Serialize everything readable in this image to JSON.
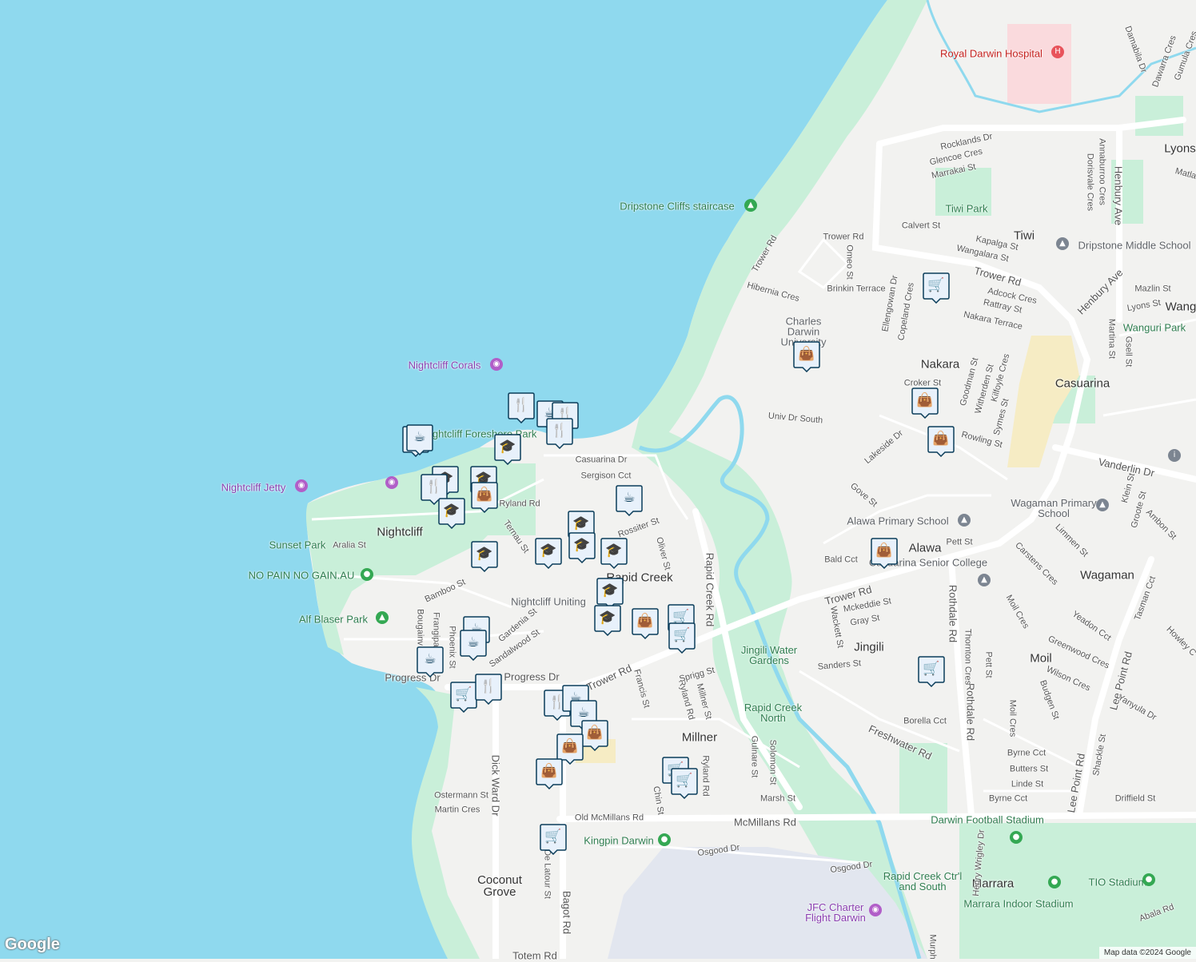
{
  "map": {
    "attribution": "Map data ©2024 Google",
    "logo": "Google",
    "colors": {
      "water": "#8fd9ee",
      "land": "#f2f2f0",
      "park": "#c9efd9",
      "road": "#ffffff",
      "hospital": "#fadadd",
      "commercial": "#f6ecc4",
      "airport": "#e6e8f0",
      "marker": "#0b3d5a",
      "markerFill": "#e8f1fb"
    }
  },
  "labels": {
    "royal_darwin_hospital": "Royal Darwin Hospital",
    "dripstone_cliffs": "Dripstone Cliffs staircase",
    "nightcliff_corals": "Nightcliff Corals",
    "nightcliff_foreshore": "Nightcliff Foreshore Park",
    "nightcliff_jetty": "Nightcliff Jetty",
    "sunset_park": "Sunset Park",
    "no_pain": "NO PAIN NO GAIN.AU",
    "alf_blaser": "Alf Blaser Park",
    "nightcliff": "Nightcliff",
    "rapid_creek": "Rapid Creek",
    "nightcliff_uniting": "Nightcliff Uniting",
    "millner": "Millner",
    "coconut_grove": "Coconut Grove",
    "kingpin": "Kingpin Darwin",
    "jfc_charter": "JFC Charter Flight Darwin",
    "rapid_creek_north": "Rapid Creek North",
    "jingili_water": "Jingili Water Gardens",
    "jingili": "Jingili",
    "moil": "Moil",
    "marrara": "Marrara",
    "tio_stadium": "TIO Stadium",
    "marrara_indoor": "Marrara Indoor Stadium",
    "darwin_football": "Darwin Football Stadium",
    "rapid_creek_ctrl": "Rapid Creek Ctr'l and South",
    "wagaman": "Wagaman",
    "wagaman_ps": "Wagaman Primary School",
    "alawa": "Alawa",
    "alawa_ps": "Alawa Primary School",
    "casuarina_sc": "Casuarina Senior College",
    "casuarina": "Casuarina",
    "nakara": "Nakara",
    "cdu": "Charles Darwin University",
    "tiwi": "Tiwi",
    "tiwi_park": "Tiwi Park",
    "dripstone_ms": "Dripstone Middle School",
    "lyons": "Lyons",
    "wanguri_park": "Wanguri Park",
    "wang": "Wang"
  },
  "streets": {
    "rocklands": "Rocklands Dr",
    "glencoe": "Glencoe Cres",
    "marrakai": "Marrakai St",
    "calvert": "Calvert St",
    "trower1": "Trower Rd",
    "trower2": "Trower Rd",
    "trower3": "Trower Rd",
    "trower4": "Trower Rd",
    "trower5": "Trower Rd",
    "kapalga": "Kapalga St",
    "wangalara": "Wangalara St",
    "adcock": "Adcock Cres",
    "rattray": "Rattray St",
    "nakara_terrace": "Nakara Terrace",
    "brinkin": "Brinkin Terrace",
    "hibernia": "Hibernia Cres",
    "omeo": "Omeo St",
    "ellengowan": "Ellengowan Dr",
    "copeland": "Copeland Cres",
    "annaburroo": "Annaburroo Cres",
    "dorisvale": "Dorisvale Cres",
    "henbury": "Henbury Ave",
    "henbury2": "Henbury Ave",
    "mazlin": "Mazlin St",
    "lyons_st": "Lyons St",
    "martina": "Martina St",
    "gsell": "Gsell St",
    "croker": "Croker St",
    "goodman": "Goodman St",
    "witherden": "Witherden St",
    "kilfoyle": "Kilfoyle Cres",
    "symes": "Symes St",
    "rowling": "Rowling St",
    "univ": "Univ Dr South",
    "lakeside": "Lakeside Dr",
    "gove": "Gove St",
    "vanderlin": "Vanderlin Dr",
    "limmen": "Limmen St",
    "ambon": "Ambon St",
    "groote": "Groote St",
    "klein": "Klein St",
    "pett": "Pett St",
    "bald": "Bald Cct",
    "carstens": "Carstens Cres",
    "mckeddie": "Mckeddie St",
    "gray": "Gray St",
    "wackett": "Wackett St",
    "sanders": "Sanders St",
    "rothdale1": "Rothdale Rd",
    "rothdale2": "Rothdale Rd",
    "thornton": "Thornton Cres",
    "petts": "Pett St",
    "moil_cres": "Moil Cres",
    "moil_cres2": "Moil Cres",
    "yeadon": "Yeadon Cct",
    "greenwood": "Greenwood Cres",
    "wilson": "Wilson Cres",
    "budgen": "Budgen St",
    "lee_point1": "Lee Point Rd",
    "lee_point2": "Lee Point Rd",
    "tasman": "Tasman Cct",
    "yanyula": "Yanyula Dr",
    "howley": "Howley C",
    "freshwater": "Freshwater Rd",
    "borella": "Borella Cct",
    "byrne": "Byrne Cct",
    "butters": "Butters St",
    "linde": "Linde St",
    "byrne2": "Byrne Cct",
    "driffield": "Driffield St",
    "shackle": "Shackle St",
    "mcmillans": "McMillans Rd",
    "old_mcmillans": "Old McMillans Rd",
    "osgood1": "Osgood Dr",
    "osgood2": "Osgood Dr",
    "henry_wrigley": "Henry Wrigley Dr",
    "abala": "Abala Rd",
    "murph": "Murph",
    "rapid_creek_rd": "Rapid Creek Rd",
    "gulnare": "Gulnare St",
    "solomon": "Solomon St",
    "marsh": "Marsh St",
    "rylandrd2": "Ryland Rd",
    "ryland3": "Ryland Rd",
    "millner_st": "Millner St",
    "sprigg": "Sprigg St",
    "francis": "Francis St",
    "chin": "Chin St",
    "bagot": "Bagot Rd",
    "de_latour": "De Latour St",
    "dick_ward": "Dick Ward Dr",
    "ostermann": "Ostermann St",
    "martin": "Martin Cres",
    "totem": "Totem Rd",
    "progress1": "Progress Dr",
    "progress2": "Progress Dr",
    "casuarina_dr": "Casuarina Dr",
    "sergison": "Sergison Cct",
    "ryland1": "Ryland Rd",
    "rossiter": "Rossiter St",
    "oliver": "Oliver St",
    "ternau": "Ternau St",
    "aralia": "Aralia St",
    "bamboo": "Bamboo St",
    "gardenia": "Gardenia St",
    "sandalwood": "Sandalwood St",
    "phoenix": "Phoenix St",
    "frangipani": "Frangipa",
    "bougain": "Bougainv",
    "dam": "Damabila Dr",
    "dawarra": "Dawarra Cres",
    "gum": "Gumula Cres",
    "matla": "Matla"
  },
  "markers": [
    {
      "type": "restaurant",
      "icon": "fork-knife-icon"
    },
    {
      "type": "cafe",
      "icon": "coffee-cup-icon"
    },
    {
      "type": "shopping",
      "icon": "shopping-bag-icon"
    },
    {
      "type": "grocery",
      "icon": "shopping-cart-icon"
    },
    {
      "type": "school",
      "icon": "graduation-cap-icon"
    }
  ]
}
